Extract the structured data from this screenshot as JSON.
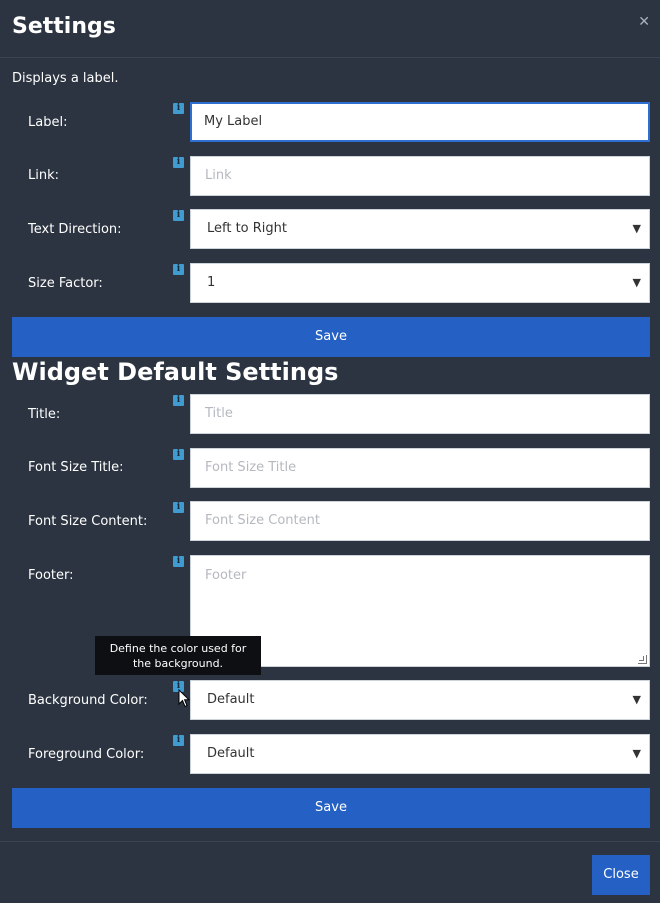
{
  "dialog": {
    "title": "Settings",
    "close_glyph": "✕",
    "description": "Displays a label."
  },
  "settings": {
    "fields": [
      {
        "label": "Label:",
        "value": "My Label",
        "placeholder": ""
      },
      {
        "label": "Link:",
        "value": "",
        "placeholder": "Link"
      },
      {
        "label": "Text Direction:",
        "value": "Left to Right"
      },
      {
        "label": "Size Factor:",
        "value": "1"
      }
    ],
    "save_label": "Save"
  },
  "widget_defaults": {
    "title": "Widget Default Settings",
    "fields": [
      {
        "label": "Title:",
        "placeholder": "Title"
      },
      {
        "label": "Font Size Title:",
        "placeholder": "Font Size Title"
      },
      {
        "label": "Font Size Content:",
        "placeholder": "Font Size Content"
      },
      {
        "label": "Footer:",
        "placeholder": "Footer"
      },
      {
        "label": "Background Color:",
        "value": "Default"
      },
      {
        "label": "Foreground Color:",
        "value": "Default"
      }
    ],
    "save_label": "Save"
  },
  "tooltip": {
    "text": "Define the color used for the background."
  },
  "footer": {
    "close_label": "Close"
  },
  "icons": {
    "info": "info-icon",
    "caret": "chevron-down-icon"
  },
  "colors": {
    "background": "#2b3440",
    "accent": "#2561c4",
    "info": "#3f9bd0"
  }
}
